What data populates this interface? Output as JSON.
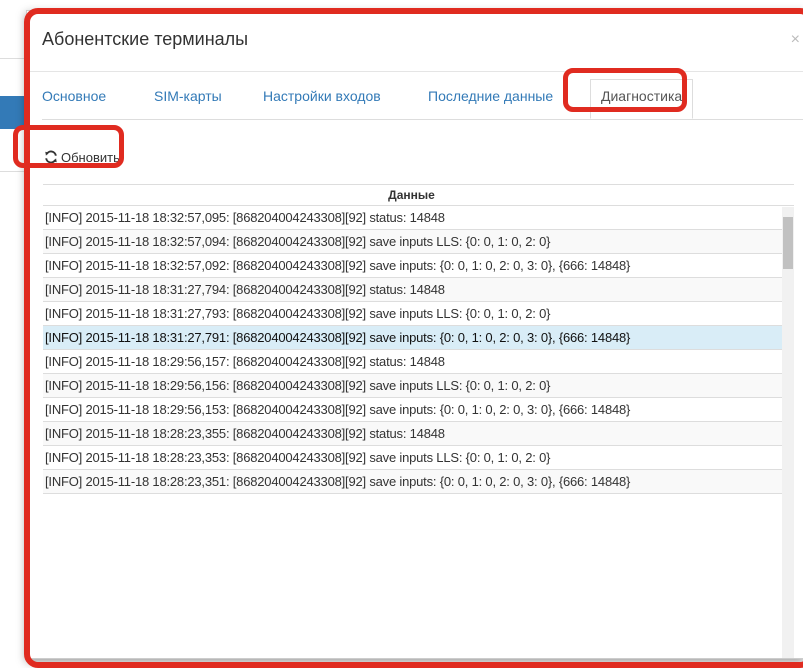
{
  "modal": {
    "title": "Абонентские терминалы",
    "close_label": "×"
  },
  "tabs": [
    {
      "label": "Основное"
    },
    {
      "label": "SIM-карты"
    },
    {
      "label": "Настройки входов"
    },
    {
      "label": "Последние данные"
    },
    {
      "label": "Диагностика"
    }
  ],
  "active_tab": "Диагностика",
  "toolbar": {
    "refresh_label": "Обновить",
    "refresh_icon": "refresh-icon"
  },
  "table": {
    "header": "Данные",
    "rows": [
      "[INFO] 2015-11-18 18:32:57,095: [868204004243308][92] status: 14848",
      "[INFO] 2015-11-18 18:32:57,094: [868204004243308][92] save inputs LLS: {0: 0, 1: 0, 2: 0}",
      "[INFO] 2015-11-18 18:32:57,092: [868204004243308][92] save inputs: {0: 0, 1: 0, 2: 0, 3: 0}, {666: 14848}",
      "[INFO] 2015-11-18 18:31:27,794: [868204004243308][92] status: 14848",
      "[INFO] 2015-11-18 18:31:27,793: [868204004243308][92] save inputs LLS: {0: 0, 1: 0, 2: 0}",
      "[INFO] 2015-11-18 18:31:27,791: [868204004243308][92] save inputs: {0: 0, 1: 0, 2: 0, 3: 0}, {666: 14848}",
      "[INFO] 2015-11-18 18:29:56,157: [868204004243308][92] status: 14848",
      "[INFO] 2015-11-18 18:29:56,156: [868204004243308][92] save inputs LLS: {0: 0, 1: 0, 2: 0}",
      "[INFO] 2015-11-18 18:29:56,153: [868204004243308][92] save inputs: {0: 0, 1: 0, 2: 0, 3: 0}, {666: 14848}",
      "[INFO] 2015-11-18 18:28:23,355: [868204004243308][92] status: 14848",
      "[INFO] 2015-11-18 18:28:23,353: [868204004243308][92] save inputs LLS: {0: 0, 1: 0, 2: 0}",
      "[INFO] 2015-11-18 18:28:23,351: [868204004243308][92] save inputs: {0: 0, 1: 0, 2: 0, 3: 0}, {666: 14848}"
    ],
    "selected_row_index": 5
  },
  "colors": {
    "link": "#337ab7",
    "highlight_red": "#e02b20",
    "selected_row": "#d9edf7"
  }
}
